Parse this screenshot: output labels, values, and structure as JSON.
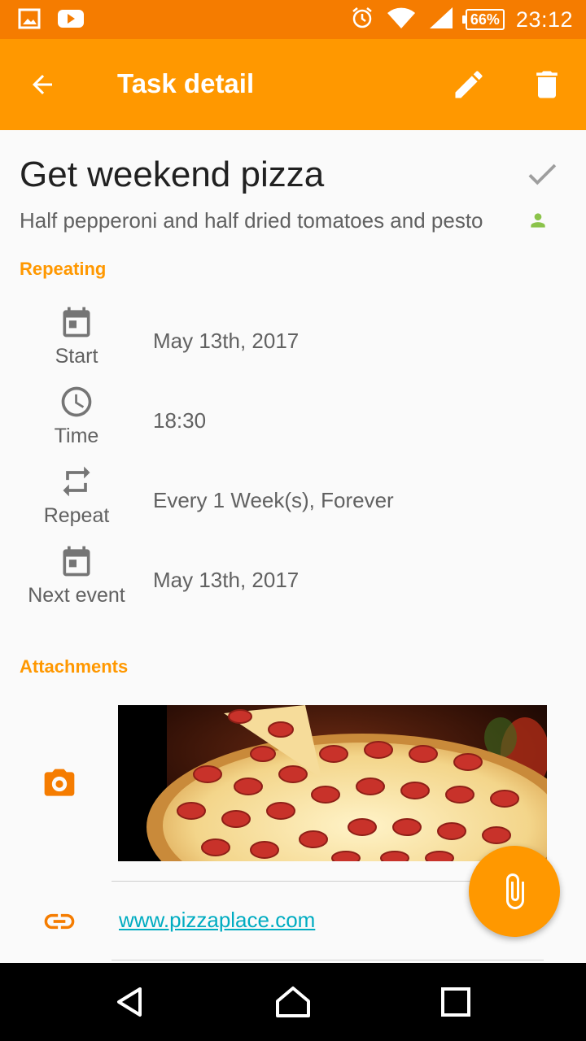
{
  "status_bar": {
    "battery_percent": "66%",
    "time": "23:12",
    "icons": [
      "gallery-icon",
      "youtube-icon",
      "alarm-icon",
      "wifi-icon",
      "signal-icon",
      "battery-icon"
    ]
  },
  "toolbar": {
    "title": "Task detail",
    "back_icon": "arrow-back-icon",
    "edit_icon": "pencil-icon",
    "delete_icon": "trash-icon",
    "background": "#ff9800"
  },
  "task": {
    "title": "Get weekend pizza",
    "description": "Half pepperoni and half dried tomatoes and pesto",
    "assignee_icon": "person-icon"
  },
  "repeating": {
    "header": "Repeating",
    "rows": [
      {
        "icon": "calendar-icon",
        "label": "Start",
        "value": "May 13th, 2017"
      },
      {
        "icon": "clock-icon",
        "label": "Time",
        "value": "18:30"
      },
      {
        "icon": "repeat-icon",
        "label": "Repeat",
        "value": "Every 1 Week(s), Forever"
      },
      {
        "icon": "calendar-icon",
        "label": "Next event",
        "value": "May 13th, 2017"
      }
    ]
  },
  "attachments": {
    "header": "Attachments",
    "image_icon": "camera-icon",
    "link_icon": "link-icon",
    "link": "www.pizzaplace.com"
  },
  "fab": {
    "icon": "paperclip-icon"
  },
  "nav": {
    "icons": [
      "back-triangle-icon",
      "home-icon",
      "recents-icon"
    ]
  },
  "colors": {
    "accent": "#ff9800",
    "status_bar": "#f57c00",
    "link": "#00acc1",
    "assignee": "#8bc34a"
  }
}
